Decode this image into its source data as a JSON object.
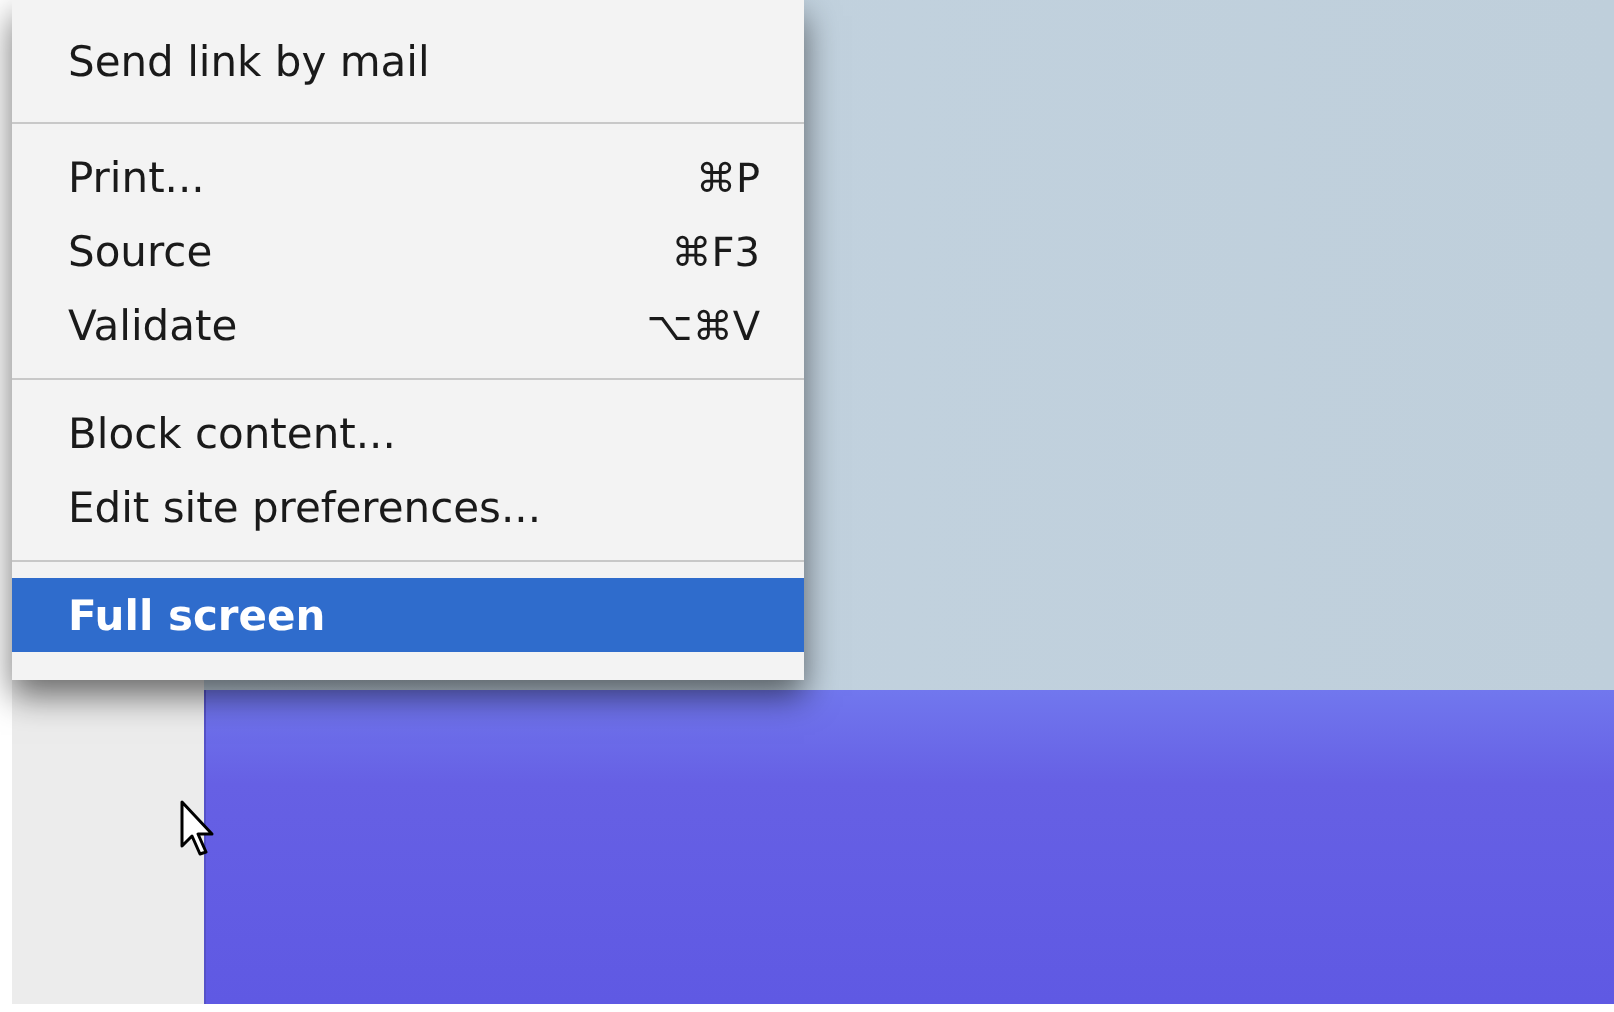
{
  "menu": {
    "sections": [
      [
        {
          "label": "Send link by mail",
          "selected": false
        }
      ],
      [
        {
          "label": "Print...",
          "shortcut": "⌘P",
          "selected": false
        },
        {
          "label": "Source",
          "shortcut": "⌘F3",
          "selected": false
        },
        {
          "label": "Validate",
          "shortcut": "⌥⌘V",
          "selected": false
        }
      ],
      [
        {
          "label": "Block content...",
          "selected": false
        },
        {
          "label": "Edit site preferences...",
          "selected": false
        }
      ],
      [
        {
          "label": "Full screen",
          "selected": true
        }
      ]
    ]
  }
}
